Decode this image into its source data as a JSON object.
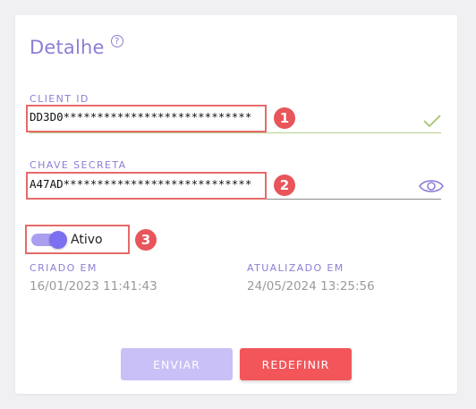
{
  "header": {
    "title": "Detalhe",
    "help_icon": "?"
  },
  "client_id": {
    "label": "CLIENT ID",
    "value": "DD3D0****************************"
  },
  "secret_key": {
    "label": "CHAVE SECRETA",
    "value": "A47AD****************************"
  },
  "active": {
    "label": "Ativo",
    "on": true
  },
  "created": {
    "label": "CRIADO EM",
    "value": "16/01/2023 11:41:43"
  },
  "updated": {
    "label": "ATUALIZADO EM",
    "value": "24/05/2024 13:25:56"
  },
  "annotations": [
    "1",
    "2",
    "3"
  ],
  "actions": {
    "send_label": "ENVIAR",
    "reset_label": "REDEFINIR"
  },
  "colors": {
    "accent": "#8b7fd3",
    "danger": "#f2565b",
    "valid_line": "#b6cf8a",
    "disabled_button": "#c8c0f7"
  }
}
